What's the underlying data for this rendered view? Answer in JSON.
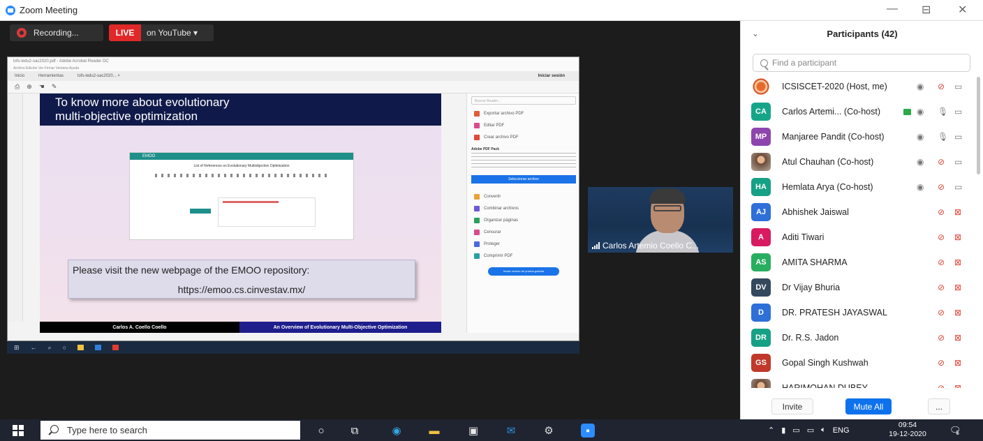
{
  "window": {
    "title": "Zoom Meeting",
    "minimize": "—",
    "restore": "⊟",
    "close": "✕"
  },
  "meeting_top": {
    "recording_label": "Recording...",
    "live_badge": "LIVE",
    "live_destination": "on YouTube ▾"
  },
  "shared_screen": {
    "acrobat_title": "lofs-iedu2-sac2020.pdf - Adobe Acrobat Reader DC",
    "acrobat_menu": "Archivo  Edición  Ver  Firmar  Ventana  Ayuda",
    "tabs": [
      "Inicio",
      "Herramientas",
      "lofs-iedu2-sac2020...  ×"
    ],
    "sign_in": "Iniciar sesión",
    "slide_heading_line1": "To know more about evolutionary",
    "slide_heading_line2": "multi-objective optimization",
    "emoo_header": "EMOO",
    "emoo_title": "List of References on Evolutionary Multiobjective Optimization",
    "visit_line1": "Please visit the new webpage of the EMOO repository:",
    "visit_line2": "https://emoo.cs.cinvestav.mx/",
    "footer_author": "Carlos A. Coello Coello",
    "footer_course": "An Overview of Evolutionary Multi-Objective Optimization",
    "right_panel": {
      "search_placeholder": "Buscar Reader…",
      "items": [
        "Exportar archivo PDF",
        "Editar PDF",
        "Crear archivo PDF"
      ],
      "pack_title": "Adobe PDF Pack",
      "select_button": "Seleccionar archivo",
      "tools": [
        "Convertir",
        "Combinar archivos",
        "Organizar páginas",
        "Censurar",
        "Proteger",
        "Comprimir PDF"
      ],
      "cta": "Iniciar versión de prueba gratuita"
    }
  },
  "video": {
    "participant_name": "Carlos Artemio Coello C..."
  },
  "participants": {
    "title": "Participants (42)",
    "search_placeholder": "Find a participant",
    "list": [
      {
        "name": "ICSISCET-2020 (Host, me)",
        "initials": "",
        "avatar_color": "#d24a1c",
        "avatar_kind": "logo",
        "video": true
      },
      {
        "name": "Carlos Artemi... (Co-host)",
        "initials": "CA",
        "avatar_color": "#17a589",
        "avatar_kind": "initials",
        "video": true,
        "sharing": true,
        "mic_on": true
      },
      {
        "name": "Manjaree Pandit (Co-host)",
        "initials": "MP",
        "avatar_color": "#8e44ad",
        "avatar_kind": "initials",
        "video": true,
        "mic_on": true
      },
      {
        "name": "Atul Chauhan (Co-host)",
        "initials": "",
        "avatar_color": "#6a4a3a",
        "avatar_kind": "photo",
        "video": true
      },
      {
        "name": "Hemlata Arya (Co-host)",
        "initials": "HA",
        "avatar_color": "#16a085",
        "avatar_kind": "initials",
        "video": true
      },
      {
        "name": "Abhishek Jaiswal",
        "initials": "AJ",
        "avatar_color": "#2e6fd8",
        "avatar_kind": "initials",
        "video": false
      },
      {
        "name": "Aditi Tiwari",
        "initials": "A",
        "avatar_color": "#d81b60",
        "avatar_kind": "initials",
        "video": false
      },
      {
        "name": "AMITA SHARMA",
        "initials": "AS",
        "avatar_color": "#27ae60",
        "avatar_kind": "initials",
        "video": false
      },
      {
        "name": "Dr Vijay Bhuria",
        "initials": "DV",
        "avatar_color": "#34495e",
        "avatar_kind": "initials",
        "video": false
      },
      {
        "name": "DR. PRATESH JAYASWAL",
        "initials": "D",
        "avatar_color": "#2e6fd8",
        "avatar_kind": "initials",
        "video": false
      },
      {
        "name": "Dr. R.S. Jadon",
        "initials": "DR",
        "avatar_color": "#16a085",
        "avatar_kind": "initials",
        "video": false
      },
      {
        "name": "Gopal Singh Kushwah",
        "initials": "GS",
        "avatar_color": "#c0392b",
        "avatar_kind": "initials",
        "video": false
      },
      {
        "name": "HARIMOHAN DUBEY",
        "initials": "",
        "avatar_color": "#6a4a3a",
        "avatar_kind": "photo",
        "video": false
      }
    ],
    "footer": {
      "invite": "Invite",
      "mute_all": "Mute All",
      "more": "..."
    },
    "colors": {
      "muted_red": "#e0463a",
      "icon_gray": "#777777",
      "sharing_green": "#2ba84a"
    }
  },
  "taskbar": {
    "search_placeholder": "Type here to search",
    "language": "ENG",
    "time": "09:54",
    "date": "19-12-2020",
    "notification_count": "5"
  }
}
